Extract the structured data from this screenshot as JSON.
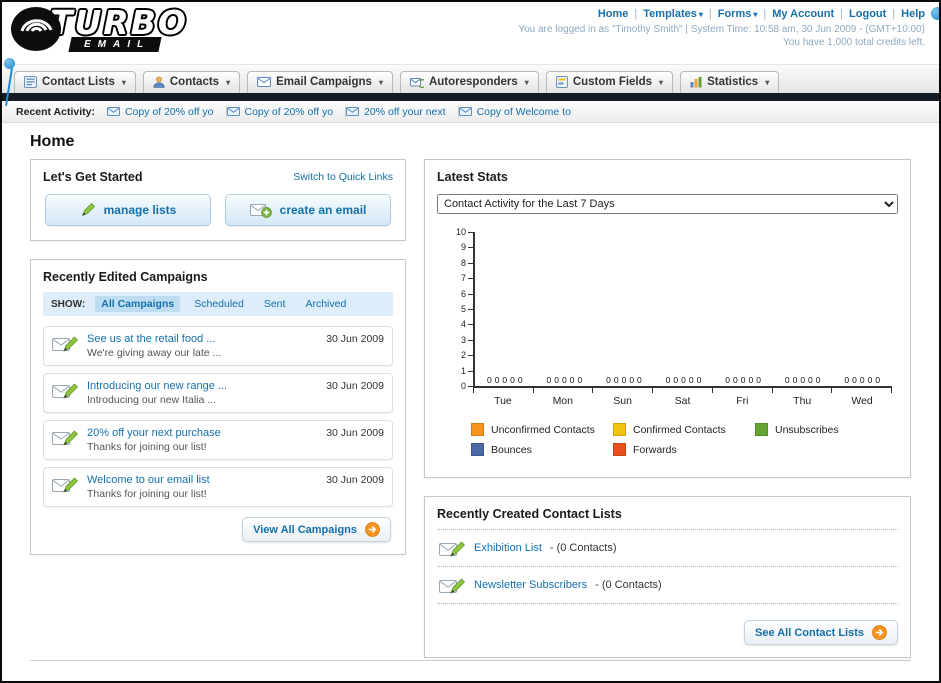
{
  "accent_colors": {
    "link": "#1470ab",
    "dark_bar": "#151b25",
    "orange": "#f7941d"
  },
  "header": {
    "logo_top": "TURBO",
    "logo_bottom": "EMAIL",
    "top_links": [
      {
        "label": "Home",
        "dropdown": false
      },
      {
        "label": "Templates",
        "dropdown": true
      },
      {
        "label": "Forms",
        "dropdown": true
      },
      {
        "label": "My Account",
        "dropdown": false
      },
      {
        "label": "Logout",
        "dropdown": false
      },
      {
        "label": "Help",
        "dropdown": false
      }
    ],
    "login_info": "You are logged in as \"Timothy Smith\" | System Time: 10:58 am, 30 Jun 2009 - (GMT+10:00)",
    "credits_info": "You have 1,000 total credits left."
  },
  "nav_tabs": [
    {
      "label": "Contact Lists",
      "icon": "contact-lists-icon"
    },
    {
      "label": "Contacts",
      "icon": "contacts-icon"
    },
    {
      "label": "Email Campaigns",
      "icon": "email-campaigns-icon"
    },
    {
      "label": "Autoresponders",
      "icon": "autoresponders-icon"
    },
    {
      "label": "Custom Fields",
      "icon": "custom-fields-icon"
    },
    {
      "label": "Statistics",
      "icon": "statistics-icon"
    }
  ],
  "recent_activity": {
    "label": "Recent Activity:",
    "items": [
      "Copy of 20% off yo",
      "Copy of 20% off yo",
      "20% off your next",
      "Copy of Welcome to"
    ]
  },
  "page_title": "Home",
  "get_started": {
    "title": "Let's Get Started",
    "switch_link": "Switch to Quick Links",
    "buttons": [
      {
        "label": "manage lists",
        "icon": "pencil-icon"
      },
      {
        "label": "create an email",
        "icon": "envelope-plus-icon"
      }
    ]
  },
  "campaigns": {
    "title": "Recently Edited Campaigns",
    "show_label": "SHOW:",
    "filters": [
      {
        "label": "All Campaigns",
        "selected": true
      },
      {
        "label": "Scheduled",
        "selected": false
      },
      {
        "label": "Sent",
        "selected": false
      },
      {
        "label": "Archived",
        "selected": false
      }
    ],
    "items": [
      {
        "title": "See us at the retail food ...",
        "subtitle": "We're giving away our late ...",
        "date": "30 Jun 2009"
      },
      {
        "title": "Introducing our new range ...",
        "subtitle": "Introducing our new Italia ...",
        "date": "30 Jun 2009"
      },
      {
        "title": "20% off your next purchase",
        "subtitle": "Thanks for joining our list!",
        "date": "30 Jun 2009"
      },
      {
        "title": "Welcome to our email list",
        "subtitle": "Thanks for joining our list!",
        "date": "30 Jun 2009"
      }
    ],
    "view_all_label": "View All Campaigns"
  },
  "latest_stats": {
    "title": "Latest Stats",
    "dropdown_value": "Contact Activity for the Last 7 Days"
  },
  "chart_data": {
    "type": "bar",
    "title": "Contact Activity for the Last 7 Days",
    "categories": [
      "Tue",
      "Mon",
      "Sun",
      "Sat",
      "Fri",
      "Thu",
      "Wed"
    ],
    "series": [
      {
        "name": "Unconfirmed Contacts",
        "color": "#f7941d",
        "values": [
          0,
          0,
          0,
          0,
          0,
          0,
          0
        ]
      },
      {
        "name": "Confirmed Contacts",
        "color": "#f2c40f",
        "values": [
          0,
          0,
          0,
          0,
          0,
          0,
          0
        ]
      },
      {
        "name": "Unsubscribes",
        "color": "#64a434",
        "values": [
          0,
          0,
          0,
          0,
          0,
          0,
          0
        ]
      },
      {
        "name": "Bounces",
        "color": "#4a69a5",
        "values": [
          0,
          0,
          0,
          0,
          0,
          0,
          0
        ]
      },
      {
        "name": "Forwards",
        "color": "#e8511d",
        "values": [
          0,
          0,
          0,
          0,
          0,
          0,
          0
        ]
      }
    ],
    "ylim": [
      0,
      10
    ],
    "y_tick_step": 1,
    "grid": false,
    "legend_position": "bottom"
  },
  "contact_lists_panel": {
    "title": "Recently Created Contact Lists",
    "items": [
      {
        "name": "Exhibition List",
        "detail": "- (0 Contacts)"
      },
      {
        "name": "Newsletter Subscribers",
        "detail": "- (0 Contacts)"
      }
    ],
    "see_all_label": "See All Contact Lists"
  }
}
